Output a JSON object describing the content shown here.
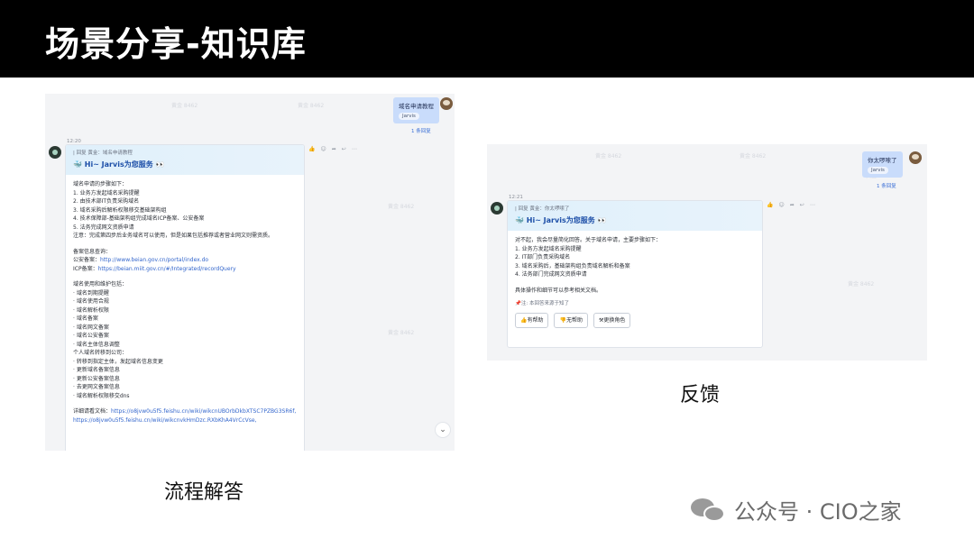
{
  "slide": {
    "title": "场景分享-知识库",
    "caption_left": "流程解答",
    "caption_right": "反馈",
    "brand_text": "公众号 · CIO之家"
  },
  "watermark": "黄金 8462",
  "left": {
    "user_message": "域名申请教程",
    "user_tag": "Jarvis",
    "reply_count": "1 条回复",
    "time": "12:20",
    "quote": "| 回复 黄金：域名申请教程",
    "greeting": "Hi~ Jarvis为您服务",
    "lines": [
      "域名申请的步骤如下：",
      "1. 业务方发起域名采购提醒",
      "2. 由技术部IT负责采购域名",
      "3. 域名采购后解析权限移交基础架构组",
      "4. 技术保障部-基础架构组完成域名ICP备案、公安备案",
      "5. 法务完成网文资质申请",
      "注意：完成第四步后业务域名可以使用，但是如果包括推荐或者营业网文则需资质。"
    ],
    "lines2_title": "备案信息查询：",
    "link_rows": [
      {
        "label": "公安备案：",
        "url": "http://www.beian.gov.cn/portal/index.do"
      },
      {
        "label": "ICP备案：",
        "url": "https://beian.miit.gov.cn/#/Integrated/recordQuery"
      }
    ],
    "lines3": [
      "域名使用和维护包括：",
      "· 域名到期提醒",
      "· 域名使用合规",
      "· 域名解析权限",
      "· 域名备案",
      "· 域名网文备案",
      "· 域名公安备案",
      "· 域名主体信息调整",
      "个人域名转移到公司：",
      "· 转移到指定主体，发起域名信息变更",
      "· 更新域名备案信息",
      "· 更新公安备案信息",
      "· 去更网文备案信息",
      "· 域名解析权限移交dns"
    ],
    "detail_label": "详细请看文档：",
    "detail_links": [
      "https://o8jvw0u5f5.feishu.cn/wiki/wikcnUBOrbDkbXTSC7PZBG3SR6f,",
      "https://o8jvw0u5f5.feishu.cn/wiki/wikcnvkHmDzc.RXbKhA4VrCcVse,"
    ],
    "scroll_icon": "chevron-down"
  },
  "right": {
    "user_message": "你太啰嗦了",
    "user_tag": "Jarvis",
    "reply_count": "1 条回复",
    "time": "12:21",
    "quote": "| 回复 黄金：你太啰嗦了",
    "greeting": "Hi~ Jarvis为您服务",
    "lines": [
      "对不起，我会尽量简化回答。关于域名申请，主要步骤如下：",
      "1. 业务方发起域名采购提醒",
      "2. IT部门负责采购域名",
      "3. 域名采购后，基础架构组负责域名解析和备案",
      "4. 法务部门完成网文资质申请"
    ],
    "closing": "具体操作和细节可以参考相关文档。",
    "note": "📌注: 本回答来源于知了",
    "buttons": [
      "👍有帮助",
      "👎无帮助",
      "⚒更换角色"
    ]
  }
}
